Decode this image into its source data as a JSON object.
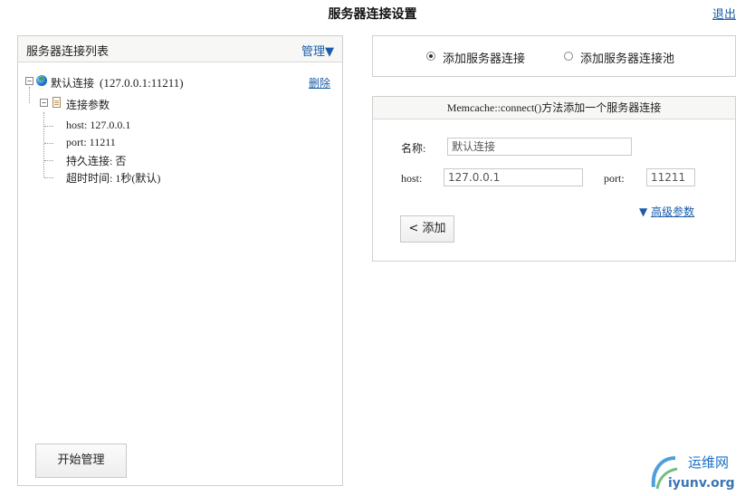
{
  "header": {
    "title": "服务器连接设置",
    "logout_label": "退出"
  },
  "left_panel": {
    "title": "服务器连接列表",
    "manage_label": "管理▼",
    "tree": {
      "root_expander": "−",
      "root_label": "默认连接",
      "root_address": "(127.0.0.1:11211)",
      "delete_label": "删除",
      "params_expander": "−",
      "params_label": "连接参数",
      "leaves": [
        "host: 127.0.0.1",
        "port: 11211",
        "持久连接: 否",
        "超时时间: 1秒(默认)"
      ]
    },
    "start_button_label": "开始管理"
  },
  "mode": {
    "options": [
      {
        "label": "添加服务器连接",
        "selected": true
      },
      {
        "label": "添加服务器连接池",
        "selected": false
      }
    ]
  },
  "form": {
    "header": "Memcache::connect()方法添加一个服务器连接",
    "name_label": "名称:",
    "name_value": "默认连接",
    "host_label": "host:",
    "host_value": "127.0.0.1",
    "port_label": "port:",
    "port_value": "11211",
    "advanced_arrow": "▼",
    "advanced_label": "高级参数",
    "add_button_label": "< 添加"
  },
  "watermark": {
    "line1": "运维网",
    "line2": "iyunv.org"
  },
  "colors": {
    "link": "#1a5ca8",
    "border": "#cfcfcf",
    "header_bg": "#f7f7f5"
  }
}
